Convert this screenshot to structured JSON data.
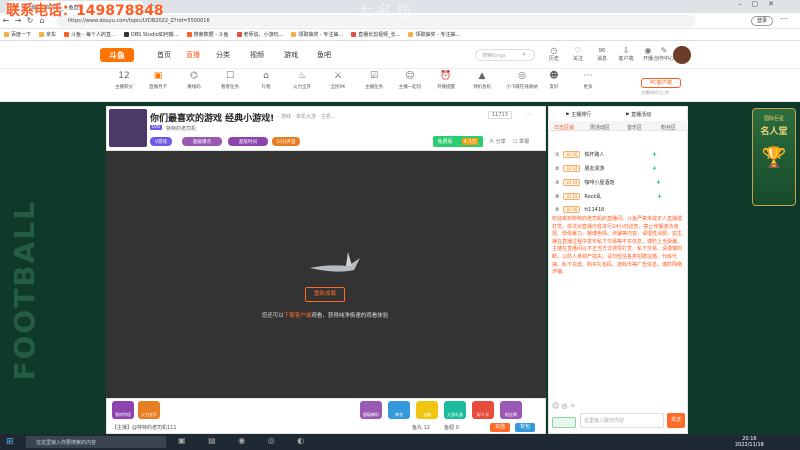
{
  "browser": {
    "tab_title": "你们最喜欢的游戏_斗鱼直播",
    "url": "https://www.douyu.com/topic/LYDB2022_Z?rid=5500016",
    "bookmarks": [
      "百度一下",
      "京东",
      "斗鱼 - 每个人的直...",
      "OBS Studio如何搬...",
      "搜索数据 - 斗鱼",
      "老师说，小游玩...",
      "领取抽奖 - 专注抽...",
      "直播长剪视频_长...",
      "领取抽奖 - 专注抽..."
    ]
  },
  "watermark": {
    "phone": "联系电话：149878848",
    "overlay": "大 名 坊"
  },
  "header": {
    "logo": "斗鱼",
    "nav": [
      "首页",
      "直播",
      "分类",
      "视频",
      "游戏",
      "鱼吧"
    ],
    "search_placeholder": "搜索Kings",
    "icons": [
      {
        "label": "历史",
        "icon": "history-icon"
      },
      {
        "label": "关注",
        "icon": "heart-icon"
      },
      {
        "label": "消息",
        "icon": "message-icon"
      },
      {
        "label": "客户端",
        "icon": "download-icon"
      },
      {
        "label": "开播",
        "icon": "broadcast-icon"
      },
      {
        "label": "创作中心",
        "icon": "create-icon"
      }
    ]
  },
  "subnav": {
    "items": [
      {
        "label": "主播积分",
        "glyph": "12"
      },
      {
        "label": "直播月卡",
        "glyph": "▣"
      },
      {
        "label": "赛线码",
        "glyph": "⌬"
      },
      {
        "label": "看客任务",
        "glyph": "☐"
      },
      {
        "label": "礼物",
        "glyph": "⌂"
      },
      {
        "label": "火力全开",
        "glyph": "♨"
      },
      {
        "label": "全民PK",
        "glyph": "⚔"
      },
      {
        "label": "主播任务",
        "glyph": "☑"
      },
      {
        "label": "主播一起玩",
        "glyph": "☺"
      },
      {
        "label": "开播提醒",
        "glyph": "⏰"
      },
      {
        "label": "领机会机",
        "glyph": "▲"
      },
      {
        "label": "小飞碟在线收纳",
        "glyph": "◎"
      },
      {
        "label": "友好",
        "glyph": "☻"
      },
      {
        "label": "更多",
        "glyph": "⋯"
      }
    ],
    "pc_button": "PC客户端",
    "pc_sub": "主播时时可上传"
  },
  "room": {
    "title": "你们最喜欢的游戏 经典小游戏!",
    "category": "单机",
    "meta": "· 游戏 · 单机大游 · 主机...",
    "streamer": "特特的老司机",
    "level": "LV6",
    "level_badge": "V游戏",
    "tags": [
      "超级爆点",
      "超级时间",
      "10分开直"
    ],
    "hot": "11713",
    "share": "分享",
    "report": "举报",
    "follow_btn": "免费看",
    "follow_count": "4.3万"
  },
  "video": {
    "replay_label": "重新加载",
    "tip_before": "您还可以",
    "tip_link": "下载客户端",
    "tip_after": "观看，获得纯净极速的观看体验"
  },
  "gifts": {
    "left": [
      "我的特权",
      "火力全开"
    ],
    "right": [
      "超级喇叭",
      "神龙",
      "宝箱",
      "大游礼盒",
      "好人卡",
      "粉丝牌"
    ],
    "balance": "鱼丸 12",
    "balance2": "鱼翅 0",
    "recharge": "充值",
    "pack": "背包",
    "user_line": "【主播】@特特的老司机111"
  },
  "chat": {
    "tabs_top": [
      "主播排行",
      "直播活动"
    ],
    "tabs": [
      "日志区域",
      "周活动区",
      "音乐区",
      "粉丝区"
    ],
    "rows": [
      {
        "lv": "LV 26",
        "name": "铁杆路人"
      },
      {
        "lv": "LV 24",
        "name": "朋友漫游"
      },
      {
        "lv": "LV 19",
        "name": "咖啡小屋酒馆"
      },
      {
        "lv": "LV 15",
        "name": "Rock乱"
      },
      {
        "lv": "LV 16",
        "name": "tt11418"
      }
    ],
    "notice": "欢迎来到特特的老司机的直播间。斗鱼严禁未成年人直播或打赏。依法对直播内容进行24小时巡查，禁止传播违法违规、低俗暴力、赌博色情、诈骗等内容。请理性消费，如主播在直播过程中发布私下交易等不实信息，谨防上当受骗。主播在直播间以不正当方式诱导打赏、私下交易、请谨慎判断，以防人身财产损失。请勿轻信各类招聘征婚、代练代抽、私下充值、购买礼包码、游戏币等广告信息，谨防网络诈骗。",
    "input_placeholder": "这里输入聊天内容",
    "send": "发送"
  },
  "banner_right": {
    "title": "名人堂",
    "subtitle": "国际巨星"
  },
  "taskbar": {
    "search": "在这里输入你要搜索的内容",
    "time": "20:16",
    "date": "2022/11/18"
  }
}
